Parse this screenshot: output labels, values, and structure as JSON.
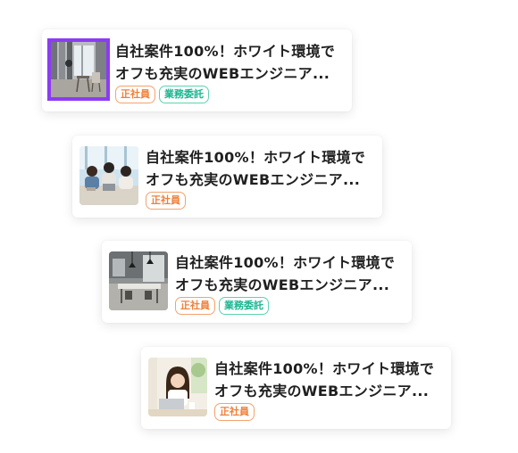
{
  "jobs": [
    {
      "title_line1": "自社案件100%！ホワイト環境で",
      "title_line2": "オフも充実のWEBエンジニア...",
      "tags": [
        "正社員",
        "業務委託"
      ],
      "thumbnail": "office-window-chairs-photo",
      "selected": true
    },
    {
      "title_line1": "自社案件100%！ホワイト環境で",
      "title_line2": "オフも充実のWEBエンジニア...",
      "tags": [
        "正社員"
      ],
      "thumbnail": "team-meeting-laptop-photo",
      "selected": false
    },
    {
      "title_line1": "自社案件100%！ホワイト環境で",
      "title_line2": "オフも充実のWEBエンジニア...",
      "tags": [
        "正社員",
        "業務委託"
      ],
      "thumbnail": "office-pendant-lamps-photo",
      "selected": false
    },
    {
      "title_line1": "自社案件100%！ホワイト環境で",
      "title_line2": "オフも充実のWEBエンジニア...",
      "tags": [
        "正社員"
      ],
      "thumbnail": "woman-laptop-smiling-photo",
      "selected": false
    }
  ],
  "colors": {
    "selection_outline": "#8b3cf3",
    "tag_employee": "#ef7f3a",
    "tag_contract": "#19b58f"
  }
}
